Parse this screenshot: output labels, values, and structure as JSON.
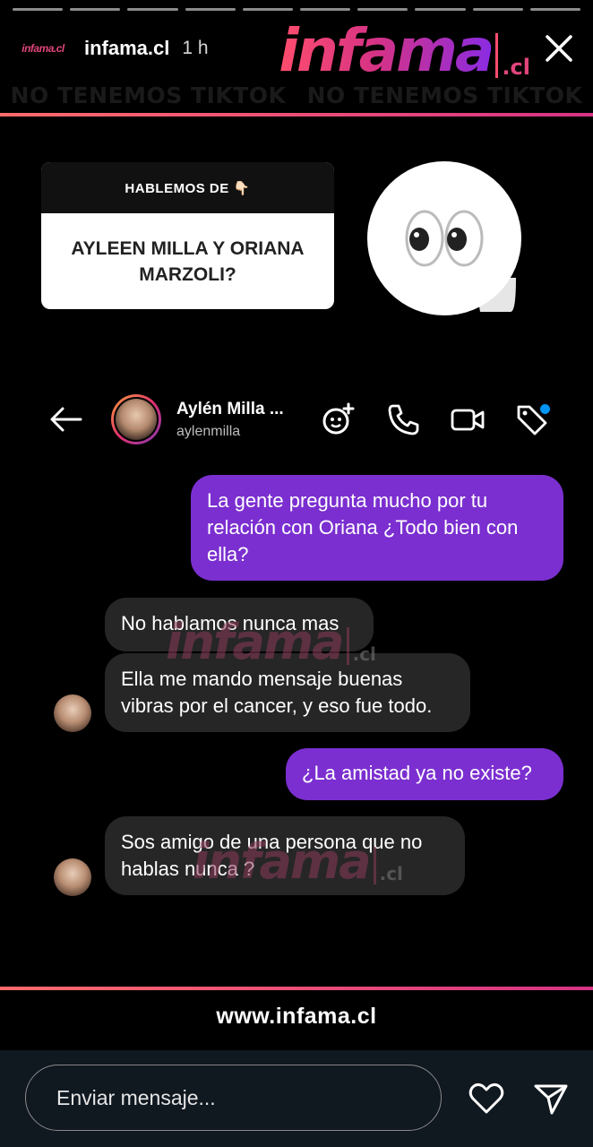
{
  "story": {
    "progress_segments": 10,
    "avatar_logo": "infama.cl",
    "username": "infama.cl",
    "time": "1 h",
    "brand_word": "infama",
    "brand_suffix": ".cl",
    "close_icon": "close-icon",
    "banner": [
      "NO TENEMOS TIKTOK",
      "NO TENEMOS TIKTOK"
    ]
  },
  "question_sticker": {
    "header": "HABLEMOS DE 👇🏻",
    "question": "AYLEEN MILLA Y ORIANA MARZOLI?"
  },
  "eyes_sticker": {
    "icon": "eyes-icon"
  },
  "dm": {
    "contact_name": "Aylén Milla ...",
    "contact_handle": "aylenmilla",
    "icons": [
      "back-arrow-icon",
      "effects-icon",
      "phone-icon",
      "video-icon",
      "tag-icon"
    ]
  },
  "messages": [
    {
      "from": "me",
      "text": "La gente pregunta mucho por tu relación con Oriana ¿Todo bien con ella?"
    },
    {
      "from": "them",
      "text": "No hablamos nunca mas"
    },
    {
      "from": "them",
      "text": "Ella me mando mensaje buenas vibras por el cancer, y eso fue todo."
    },
    {
      "from": "me",
      "text": "¿La amistad ya no existe?"
    },
    {
      "from": "them",
      "text": "Sos amigo de una persona que no hablas nunca ?"
    }
  ],
  "watermark": {
    "word": "infama",
    "suffix": ".cl"
  },
  "footer": {
    "site_url": "www.infama.cl",
    "reply_placeholder": "Enviar mensaje...",
    "like_icon": "heart-icon",
    "send_icon": "send-icon"
  },
  "colors": {
    "sent_bubble": "#7b2fd0",
    "received_bubble": "#262626",
    "accent_line": "#ff6b6b",
    "brand_pink": "#d63384"
  }
}
